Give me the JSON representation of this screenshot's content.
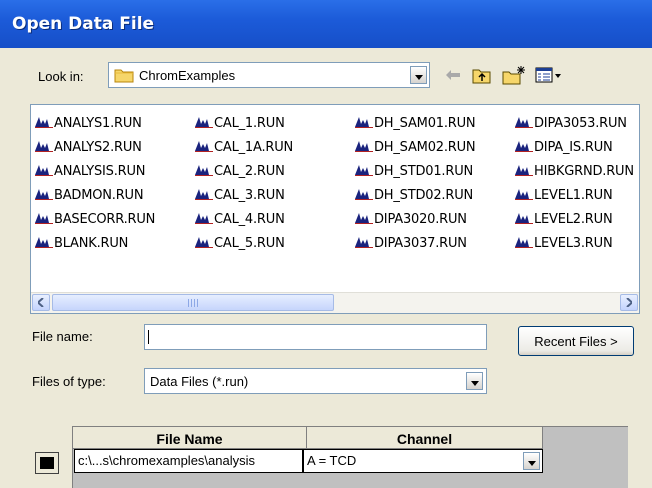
{
  "window": {
    "title": "Open Data File"
  },
  "lookin": {
    "label": "Look in:",
    "value": "ChromExamples"
  },
  "toolbar": {
    "icons": [
      "back-arrow-icon",
      "up-folder-icon",
      "new-folder-icon",
      "view-menu-icon"
    ]
  },
  "files": {
    "columns": [
      [
        "ANALYS1.RUN",
        "ANALYS2.RUN",
        "ANALYSIS.RUN",
        "BADMON.RUN",
        "BASECORR.RUN",
        "BLANK.RUN"
      ],
      [
        "CAL_1.RUN",
        "CAL_1A.RUN",
        "CAL_2.RUN",
        "CAL_3.RUN",
        "CAL_4.RUN",
        "CAL_5.RUN"
      ],
      [
        "DH_SAM01.RUN",
        "DH_SAM02.RUN",
        "DH_STD01.RUN",
        "DH_STD02.RUN",
        "DIPA3020.RUN",
        "DIPA3037.RUN"
      ],
      [
        "DIPA3053.RUN",
        "DIPA_IS.RUN",
        "HIBKGRND.RUN",
        "LEVEL1.RUN",
        "LEVEL2.RUN",
        "LEVEL3.RUN"
      ]
    ],
    "icon": "chromatogram-file-icon"
  },
  "filename": {
    "label": "File name:",
    "value": ""
  },
  "recent_button": {
    "label": "Recent Files >"
  },
  "filetype": {
    "label": "Files of type:",
    "value": "Data Files (*.run)"
  },
  "grid": {
    "headers": [
      "File Name",
      "Channel"
    ],
    "row": {
      "file": "c:\\...s\\chromexamples\\analysis",
      "channel": "A = TCD"
    }
  },
  "colors": {
    "title_bar": "#1C5BD9",
    "dialog_bg": "#ECE9D8",
    "file_icon": "#1A237E"
  }
}
